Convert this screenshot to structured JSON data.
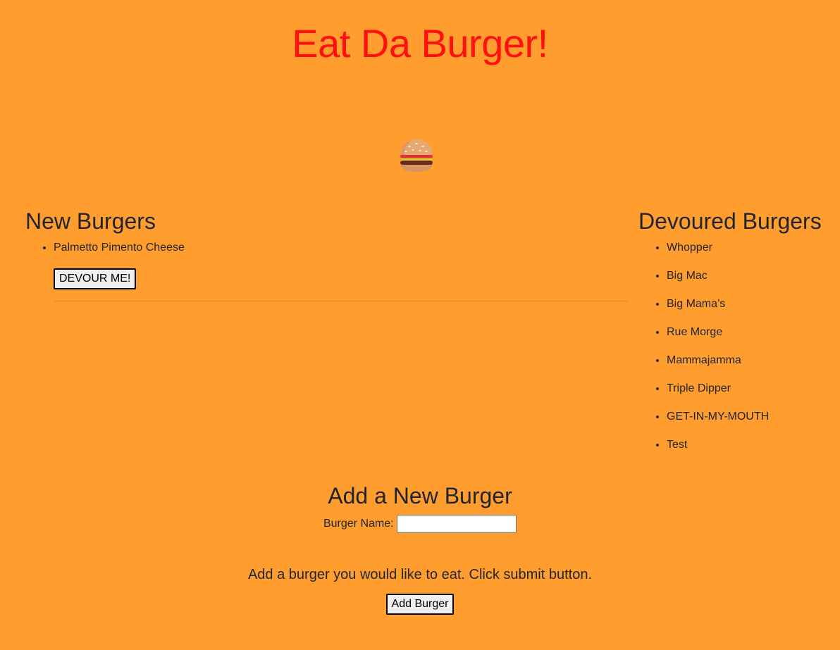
{
  "header": {
    "title": "Eat Da Burger!",
    "title_color": "#ff1010"
  },
  "hero": {
    "icon": "hamburger-icon"
  },
  "new_burgers": {
    "title": "New Burgers",
    "items": [
      {
        "name": "Palmetto Pimento Cheese",
        "button_label": "DEVOUR ME!"
      }
    ]
  },
  "devoured_burgers": {
    "title": "Devoured Burgers",
    "items": [
      "Whopper",
      "Big Mac",
      "Big Mama’s",
      "Rue Morge",
      "Mammajamma",
      "Triple Dipper",
      "GET-IN-MY-MOUTH",
      "Test"
    ]
  },
  "add_form": {
    "title": "Add a New Burger",
    "name_label": "Burger Name:",
    "name_value": "",
    "instruction": "Add a burger you would like to eat. Click submit button.",
    "submit_label": "Add Burger"
  },
  "colors": {
    "background": "#ff9e2f",
    "text": "#212529"
  }
}
